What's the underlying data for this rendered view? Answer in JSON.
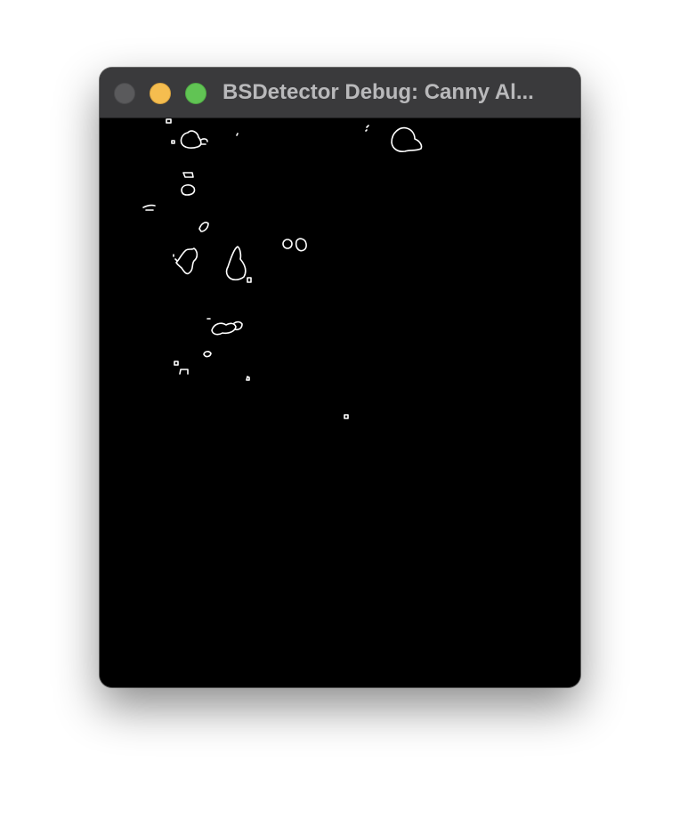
{
  "window": {
    "title": "BSDetector Debug: Canny Al..."
  },
  "controls": {
    "close": "close-button",
    "minimize": "minimize-button",
    "zoom": "zoom-button"
  },
  "colors": {
    "titlebar": "#3a3a3c",
    "title_text": "#b9b9bb",
    "canvas_background": "#000000",
    "edge_stroke": "#ffffff",
    "close": "#5a5a5c",
    "minimize": "#f5bd4f",
    "zoom": "#61c454"
  }
}
